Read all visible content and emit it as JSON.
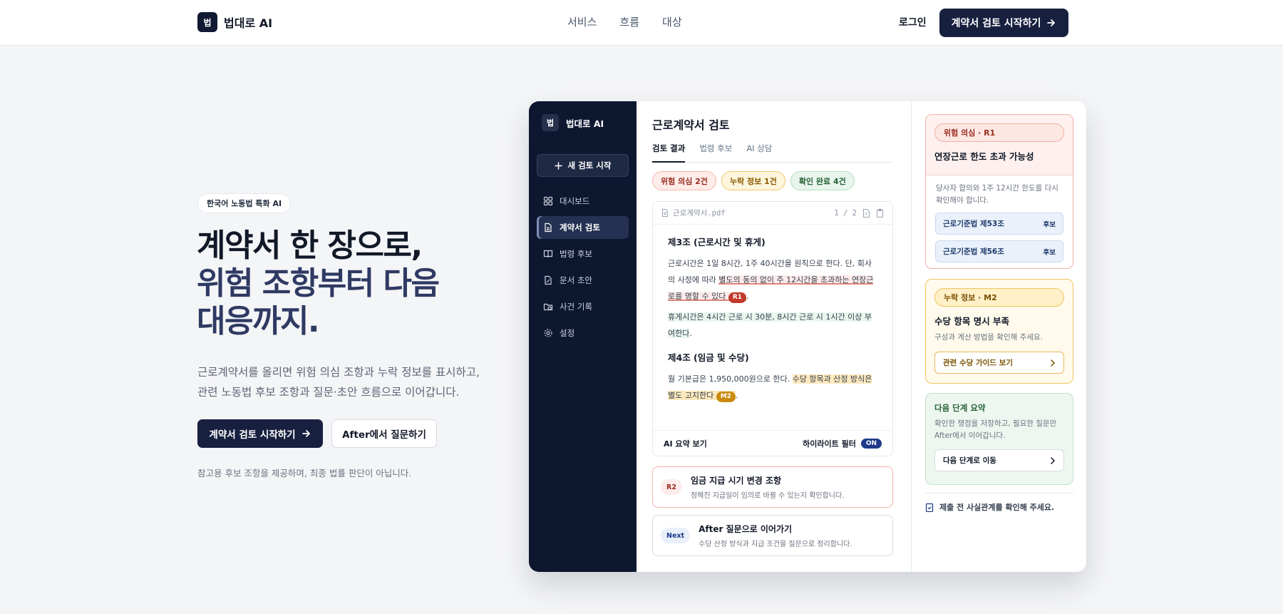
{
  "header": {
    "brand_mark": "법",
    "brand_name": "법대로 AI",
    "nav": [
      "서비스",
      "흐름",
      "대상"
    ],
    "login": "로그인",
    "cta": "계약서 검토 시작하기"
  },
  "hero": {
    "badge": "한국어 노동법 특화 AI",
    "title_line1": "계약서 한 장으로,",
    "title_line2": "위험 조항부터 다음",
    "title_line3": "대응까지.",
    "desc_line1": "근로계약서를 올리면 위험 의심 조항과 누락 정보를 표시하고,",
    "desc_line2": "관련 노동법 후보 조항과 질문·초안 흐름으로 이어갑니다.",
    "primary_button": "계약서 검토 시작하기",
    "secondary_button": "After에서 질문하기",
    "note": "참고용 후보 조항을 제공하며, 최종 법률 판단이 아닙니다."
  },
  "app": {
    "sidebar": {
      "brand_mark": "법",
      "brand_name": "법대로 AI",
      "new_review": "새 검토 시작",
      "items": [
        {
          "label": "대시보드",
          "icon": "grid-icon"
        },
        {
          "label": "계약서 검토",
          "icon": "document-icon"
        },
        {
          "label": "법령 후보",
          "icon": "book-icon"
        },
        {
          "label": "문서 초안",
          "icon": "draft-icon"
        },
        {
          "label": "사건 기록",
          "icon": "folder-clock-icon"
        },
        {
          "label": "설정",
          "icon": "gear-icon"
        }
      ],
      "active_index": 1
    },
    "main": {
      "title": "근로계약서 검토",
      "tabs": [
        "검토 결과",
        "법령 후보",
        "AI 상담"
      ],
      "pills": {
        "risk": "위험 의심 2건",
        "missing": "누락 정보 1건",
        "confirmed": "확인 완료 4건"
      },
      "doc": {
        "filename": "근로계약서.pdf",
        "page": "1 / 2",
        "section1_title": "제3조 (근로시간 및 휴게)",
        "s1_text_a": "근로시간은 1일 8시간, 1주 40시간을 원칙으로 한다. 단, 회사의 사정에 따라 ",
        "s1_hl_red": "별도의 동의 없이 주 12시간을 초과하는 연장근로를 명할 수 있다",
        "s1_tag": "R1",
        "s1_text_b": ".",
        "s1_hl_green": "휴게시간은 4시간 근로 시 30분, 8시간 근로 시 1시간 이상 부여한다",
        "s1_text_c": ".",
        "section2_title": "제4조 (임금 및 수당)",
        "s2_text_a": "월 기본급은 1,950,000원으로 한다. ",
        "s2_hl_amber": "수당 항목과 산정 방식은 별도 고지한다",
        "s2_tag": "M2",
        "s2_text_b": ".",
        "footer_left": "AI 요약 보기",
        "footer_right": "하이라이트 필터",
        "toggle": "ON"
      },
      "cards": [
        {
          "badge": "R2",
          "title": "임금 지급 시기 변경 조항",
          "desc": "정해진 지급일이 임의로 바뀔 수 있는지 확인합니다."
        },
        {
          "badge": "Next",
          "title": "After 질문으로 이어가기",
          "desc": "수당 산정 방식과 지급 조건을 질문으로 정리합니다."
        }
      ]
    },
    "rail": {
      "risk": {
        "chip": "위험 의심 · R1",
        "title": "연장근로 한도 초과 가능성",
        "desc": "당사자 합의와 1주 12시간 한도를 다시 확인해야 합니다.",
        "laws": [
          {
            "name": "근로기준법 제53조",
            "tag": "후보"
          },
          {
            "name": "근로기준법 제56조",
            "tag": "후보"
          }
        ]
      },
      "missing": {
        "chip": "누락 정보 · M2",
        "title": "수당 항목 명시 부족",
        "desc": "구성과 계산 방법을 확인해 주세요.",
        "button": "관련 수당 가이드 보기"
      },
      "next": {
        "title": "다음 단계 요약",
        "desc": "확인한 쟁점을 저장하고, 필요한 질문만 After에서 이어갑니다.",
        "button": "다음 단계로 이동"
      },
      "note": "제출 전 사실관계를 확인해 주세요."
    }
  },
  "colors": {
    "navy": "#17203f",
    "sidebar": "#0d1730",
    "risk": "#c0392b",
    "missing": "#c98a0c",
    "confirmed": "#27623a"
  }
}
